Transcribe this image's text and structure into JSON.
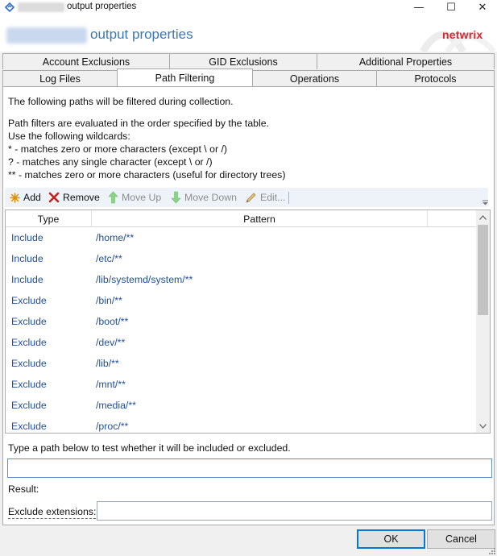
{
  "window": {
    "title": "output properties",
    "minimize_glyph": "—",
    "maximize_glyph": "☐",
    "close_glyph": "✕"
  },
  "header": {
    "title": "output properties",
    "logo": "netwrix",
    "brand_color": "#d8262f",
    "title_color": "#3a77b7"
  },
  "tabs": {
    "row1": [
      "Account Exclusions",
      "GID Exclusions",
      "Additional Properties"
    ],
    "row2": [
      "Log Files",
      "Path Filtering",
      "Operations",
      "Protocols"
    ],
    "active": "Path Filtering"
  },
  "content": {
    "intro": "The following paths will be filtered during collection.",
    "info_lines": [
      "Path filters are evaluated in the order specified by the table.",
      "Use the following wildcards:",
      "* - matches zero or more characters (except \\ or /)",
      "? - matches any single character (except \\ or /)",
      "** - matches zero or more characters (useful for directory trees)"
    ]
  },
  "toolbar": {
    "add": "Add",
    "remove": "Remove",
    "move_up": "Move Up",
    "move_down": "Move Down",
    "edit": "Edit..."
  },
  "grid": {
    "columns": [
      "Type",
      "Pattern"
    ],
    "rows": [
      {
        "type": "Include",
        "pattern": "/home/**"
      },
      {
        "type": "Include",
        "pattern": "/etc/**"
      },
      {
        "type": "Include",
        "pattern": "/lib/systemd/system/**"
      },
      {
        "type": "Exclude",
        "pattern": "/bin/**"
      },
      {
        "type": "Exclude",
        "pattern": "/boot/**"
      },
      {
        "type": "Exclude",
        "pattern": "/dev/**"
      },
      {
        "type": "Exclude",
        "pattern": "/lib/**"
      },
      {
        "type": "Exclude",
        "pattern": "/mnt/**"
      },
      {
        "type": "Exclude",
        "pattern": "/media/**"
      },
      {
        "type": "Exclude",
        "pattern": "/proc/**"
      }
    ]
  },
  "test": {
    "prompt": "Type a path below to test whether it will be included or excluded.",
    "value": "",
    "result_label": "Result:",
    "exclude_extensions_label": "Exclude extensions:",
    "exclude_extensions_value": ""
  },
  "footer": {
    "ok": "OK",
    "cancel": "Cancel"
  }
}
